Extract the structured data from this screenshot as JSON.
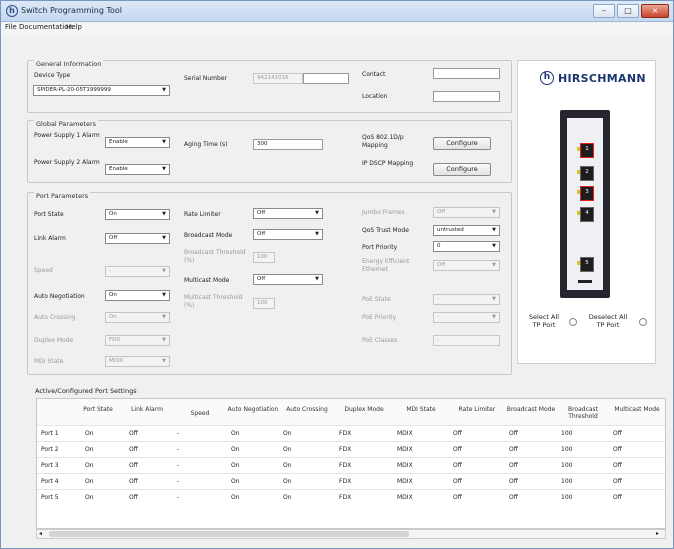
{
  "window": {
    "title": "Switch Programming Tool",
    "min": "–",
    "max": "□",
    "close": "×"
  },
  "menu": [
    "File",
    "Documentation",
    "Help"
  ],
  "general": {
    "title": "General Information",
    "device_type_label": "Device Type",
    "device_type_value": "SPIDER-PL-20-05T1999999",
    "serial_label": "Serial Number",
    "serial_value": "942141016",
    "contact_label": "Contact",
    "location_label": "Location"
  },
  "global": {
    "title": "Global Parameters",
    "ps1_label": "Power Supply 1 Alarm",
    "ps1_value": "Enable",
    "ps2_label": "Power Supply 2 Alarm",
    "ps2_value": "Enable",
    "aging_label": "Aging Time (s)",
    "aging_value": "300",
    "qos_label": "QoS 802.1D/p Mapping",
    "qos_button": "Configure",
    "dscp_label": "IP DSCP Mapping",
    "dscp_button": "Configure"
  },
  "port_params": {
    "title": "Port Parameters",
    "port_state": {
      "label": "Port State",
      "value": "On"
    },
    "link_alarm": {
      "label": "Link Alarm",
      "value": "Off"
    },
    "speed": {
      "label": "Speed",
      "value": "-"
    },
    "auto_neg": {
      "label": "Auto Negotiation",
      "value": "On"
    },
    "auto_cross": {
      "label": "Auto Crossing",
      "value": "On"
    },
    "duplex": {
      "label": "Duplex Mode",
      "value": "FDX"
    },
    "mdi": {
      "label": "MDI State",
      "value": "MDIX"
    },
    "rate_limiter": {
      "label": "Rate Limiter",
      "value": "Off"
    },
    "bcast_mode": {
      "label": "Broadcast Mode",
      "value": "Off"
    },
    "bcast_thresh": {
      "label": "Broadcast Threshold (%)",
      "value": "100"
    },
    "mcast_mode": {
      "label": "Multicast Mode",
      "value": "Off"
    },
    "mcast_thresh": {
      "label": "Multicast Threshold (%)",
      "value": "100"
    },
    "jumbo": {
      "label": "Jumbo Frames",
      "value": "Off"
    },
    "qos_trust": {
      "label": "QoS Trust Mode",
      "value": "untrusted"
    },
    "priority": {
      "label": "Port Priority",
      "value": "0"
    },
    "eee": {
      "label": "Energy Efficient Ethernet",
      "value": "Off"
    },
    "poe_state": {
      "label": "PoE State",
      "value": "-"
    },
    "poe_priority": {
      "label": "PoE Priority",
      "value": "-"
    },
    "poe_classes": {
      "label": "PoE Classes",
      "value": "-"
    }
  },
  "device": {
    "logo": "HIRSCHMANN",
    "logo_glyph": "h",
    "ports": [
      "1",
      "2",
      "3",
      "4",
      "5"
    ],
    "select_all": "Select All TP Port",
    "deselect_all": "Deselect All TP Port"
  },
  "table": {
    "title": "Active/Configured Port Settings",
    "headers": [
      "",
      "Port State",
      "Link Alarm",
      "Speed",
      "Auto Negotiation",
      "Auto Crossing",
      "Duplex Mode",
      "MDI State",
      "Rate Limiter",
      "Broadcast Mode",
      "Broadcast Threshold",
      "Multicast Mode"
    ],
    "rows": [
      [
        "Port 1",
        "On",
        "Off",
        "-",
        "On",
        "On",
        "FDX",
        "MDIX",
        "Off",
        "Off",
        "100",
        "Off"
      ],
      [
        "Port 2",
        "On",
        "Off",
        "-",
        "On",
        "On",
        "FDX",
        "MDIX",
        "Off",
        "Off",
        "100",
        "Off"
      ],
      [
        "Port 3",
        "On",
        "Off",
        "-",
        "On",
        "On",
        "FDX",
        "MDIX",
        "Off",
        "Off",
        "100",
        "Off"
      ],
      [
        "Port 4",
        "On",
        "Off",
        "-",
        "On",
        "On",
        "FDX",
        "MDIX",
        "Off",
        "Off",
        "100",
        "Off"
      ],
      [
        "Port 5",
        "On",
        "Off",
        "-",
        "On",
        "On",
        "FDX",
        "MDIX",
        "Off",
        "Off",
        "100",
        "Off"
      ]
    ]
  },
  "colors": {
    "selected_port": "#e42020",
    "brand": "#1c3570"
  }
}
